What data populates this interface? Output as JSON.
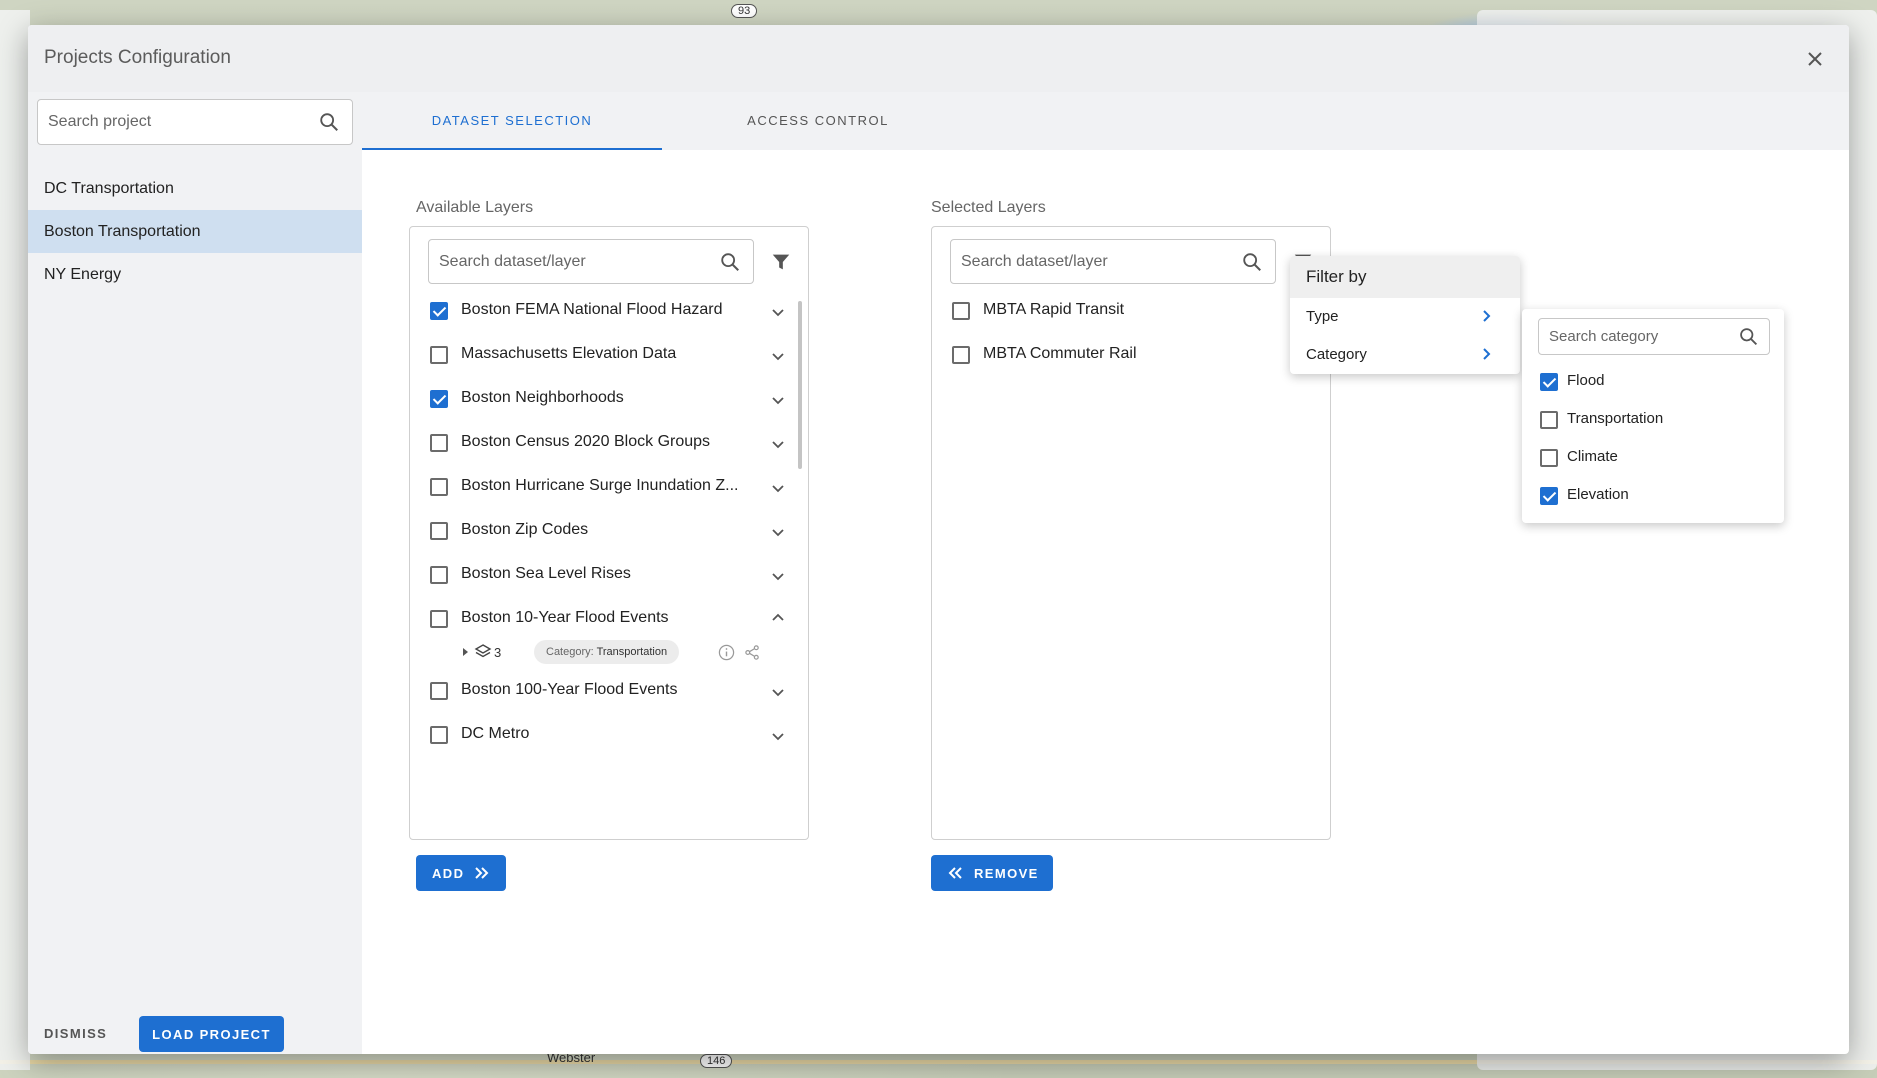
{
  "map": {
    "labels": [
      "Webster"
    ],
    "shields": [
      "93",
      "146"
    ]
  },
  "dialog": {
    "title": "Projects Configuration",
    "close_icon": "close-icon"
  },
  "sidebar": {
    "search_placeholder": "Search project",
    "projects": [
      {
        "label": "DC Transportation",
        "selected": false
      },
      {
        "label": "Boston Transportation",
        "selected": true
      },
      {
        "label": "NY Energy",
        "selected": false
      }
    ],
    "dismiss_label": "DISMISS",
    "load_label": "LOAD PROJECT"
  },
  "tabs": [
    {
      "label": "DATASET SELECTION",
      "active": true
    },
    {
      "label": "ACCESS CONTROL",
      "active": false
    }
  ],
  "available": {
    "label": "Available Layers",
    "search_placeholder": "Search dataset/layer",
    "layers": [
      {
        "label": "Boston FEMA National Flood Hazard",
        "checked": true,
        "expanded": false
      },
      {
        "label": "Massachusetts Elevation Data",
        "checked": false,
        "expanded": false
      },
      {
        "label": "Boston Neighborhoods",
        "checked": true,
        "expanded": false
      },
      {
        "label": "Boston Census 2020 Block Groups",
        "checked": false,
        "expanded": false
      },
      {
        "label": "Boston Hurricane Surge Inundation Z...",
        "checked": false,
        "expanded": false
      },
      {
        "label": "Boston Zip Codes",
        "checked": false,
        "expanded": false
      },
      {
        "label": "Boston Sea Level Rises",
        "checked": false,
        "expanded": false
      },
      {
        "label": "Boston 10-Year Flood Events",
        "checked": false,
        "expanded": true
      },
      {
        "label": "Boston 100-Year Flood Events",
        "checked": false,
        "expanded": false
      },
      {
        "label": "DC Metro",
        "checked": false,
        "expanded": false
      }
    ],
    "expanded_details": {
      "layer_count": "3",
      "category_key": "Category:",
      "category_value": "Transportation"
    },
    "add_label": "ADD"
  },
  "selected": {
    "label": "Selected Layers",
    "search_placeholder": "Search dataset/layer",
    "layers": [
      {
        "label": "MBTA Rapid Transit",
        "checked": false
      },
      {
        "label": "MBTA Commuter Rail",
        "checked": false
      }
    ],
    "remove_label": "REMOVE"
  },
  "filter_menu": {
    "title": "Filter by",
    "items": [
      "Type",
      "Category"
    ]
  },
  "category_menu": {
    "search_placeholder": "Search category",
    "options": [
      {
        "label": "Flood",
        "checked": true
      },
      {
        "label": "Transportation",
        "checked": false
      },
      {
        "label": "Climate",
        "checked": false
      },
      {
        "label": "Elevation",
        "checked": true
      }
    ]
  },
  "colors": {
    "accent": "#1e6fd1",
    "selected_project_bg": "#cfdff0"
  }
}
